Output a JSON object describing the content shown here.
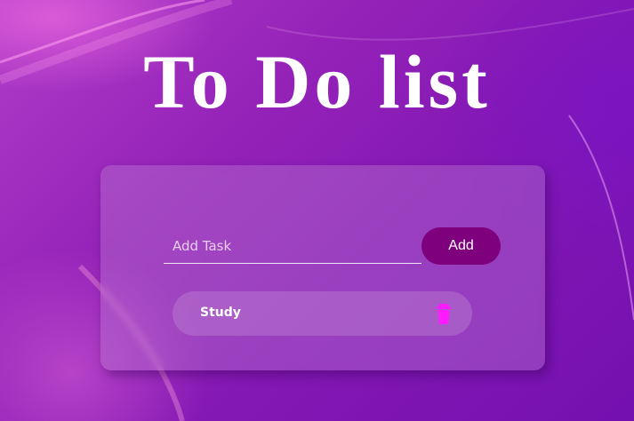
{
  "header": {
    "title": "To Do list"
  },
  "form": {
    "placeholder": "Add Task",
    "value": "",
    "add_label": "Add"
  },
  "tasks": [
    {
      "text": "Study",
      "delete_icon": "trash-icon"
    }
  ],
  "colors": {
    "background_start": "#b03cc8",
    "background_end": "#7410b0",
    "add_button": "#7f007c",
    "trash_icon": "#ff1aff"
  }
}
